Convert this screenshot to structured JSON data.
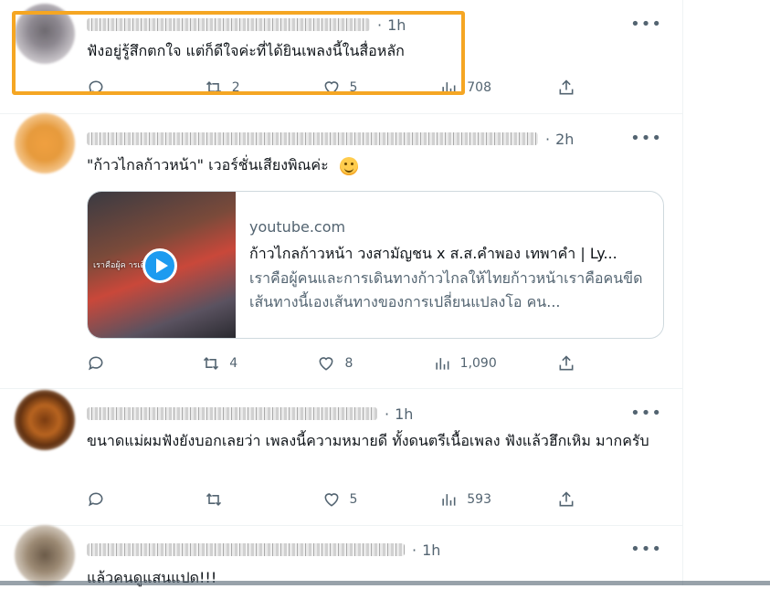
{
  "tweets": [
    {
      "time": "1h",
      "text": "ฟังอยู่รู้สึกตกใจ แต่ก็ดีใจค่ะที่ได้ยินเพลงนี้ในสื่อหลัก",
      "actions": {
        "reply": "",
        "retweet": "2",
        "like": "5",
        "views": "708"
      }
    },
    {
      "time": "2h",
      "text": "\"ก้าวไกลก้าวหน้า\" เวอร์ชั่นเสียงพิณค่ะ",
      "card": {
        "domain": "youtube.com",
        "title": "ก้าวไกลก้าวหน้า วงสามัญชน x ส.ส.คำพอง เทพาคำ | Ly...",
        "description": "เราคือผู้คนและการเดินทางก้าวไกลให้ไทยก้าวหน้าเราคือคนขีดเส้นทางนี้เองเส้นทางของการเปลี่ยนแปลงโอ คน...",
        "thumb_caption": "เราคือผู้ค    ารเดินทาง"
      },
      "actions": {
        "reply": "",
        "retweet": "4",
        "like": "8",
        "views": "1,090"
      }
    },
    {
      "time": "1h",
      "text": "ขนาดแม่ผมฟังยังบอกเลยว่า เพลงนี้ความหมายดี ทั้งดนตรีเนื้อเพลง ฟังแล้วฮึกเหิม มากครับ",
      "actions": {
        "reply": "",
        "retweet": "",
        "like": "5",
        "views": "593"
      }
    },
    {
      "time": "1h",
      "text": "แล้วคนดูแสนแปด!!!"
    }
  ],
  "ui": {
    "dot": "·",
    "more": "•••"
  },
  "colors": {
    "highlight": "#f5a623",
    "accent": "#1d9bf0",
    "muted": "#536471"
  }
}
